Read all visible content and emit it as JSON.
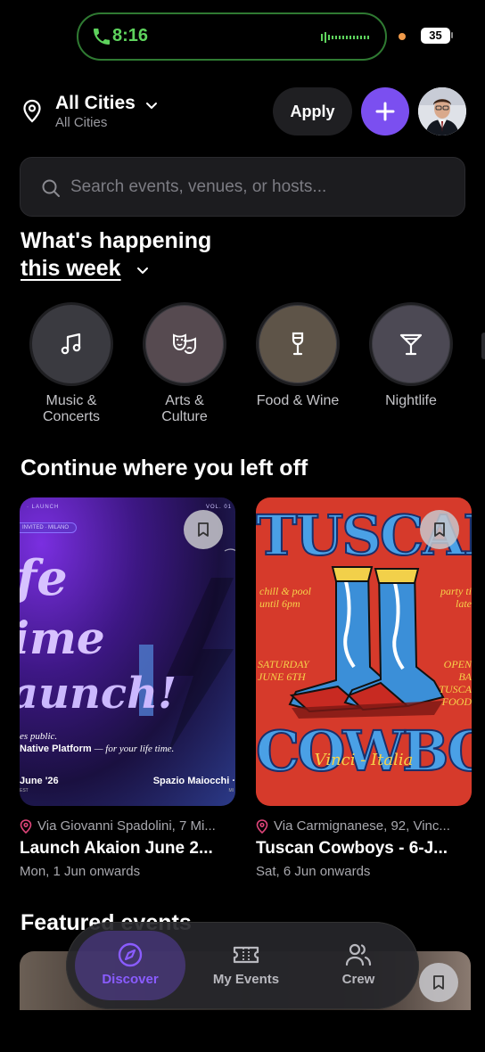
{
  "status": {
    "call_time": "8:16",
    "battery": "35"
  },
  "header": {
    "city_title": "All Cities",
    "city_subtitle": "All Cities",
    "apply_label": "Apply"
  },
  "search": {
    "placeholder": "Search events, venues, or hosts..."
  },
  "section": {
    "happening": "What's happening",
    "period": "this week",
    "continue": "Continue where you left off",
    "featured": "Featured events"
  },
  "categories": [
    {
      "label": "Music & Concerts",
      "color": "#3a3a40"
    },
    {
      "label": "Arts & Culture",
      "color": "#564a50"
    },
    {
      "label": "Food & Wine",
      "color": "#5e5448"
    },
    {
      "label": "Nightlife",
      "color": "#4c4954"
    }
  ],
  "cards": [
    {
      "location": "Via Giovanni Spadolini, 7 Mi...",
      "title": "Launch Akaion June 2...",
      "date": "Mon, 1 Jun onwards",
      "poster": {
        "top_left": "· LAUNCH",
        "top_right": "VOL. 01",
        "badge": "INVITED · MILANO",
        "line1": "fe",
        "line2": "ime",
        "line3": "aunch!",
        "sub1": "es public.",
        "sub2": "Native Platform",
        "sub3": "— for your life time.",
        "bottom_left": "June '26",
        "bottom_left_small": "EST",
        "bottom_right": "Spazio Maiocchi ·",
        "bottom_right_small": "MI"
      }
    },
    {
      "location": "Via Carmignanese, 92, Vinc...",
      "title": "Tuscan Cowboys - 6-J...",
      "date": "Sat, 6 Jun onwards",
      "poster": {
        "top": "TUSCAN",
        "bottom": "COWBOY",
        "left_top": "chill & pool until 6pm",
        "right_top": "party ti late",
        "left_mid": "SATURDAY JUNE 6TH",
        "right_mid": "OPEN BA TUSCA FOOD",
        "script": "Vinci - Italia"
      }
    }
  ],
  "nav": [
    {
      "label": "Discover",
      "icon": "compass-icon",
      "active": true
    },
    {
      "label": "My Events",
      "icon": "ticket-icon",
      "active": false
    },
    {
      "label": "Crew",
      "icon": "users-icon",
      "active": false
    }
  ],
  "colors": {
    "accent": "#7b4ff0",
    "call_green": "#5ed35d",
    "poster_red": "#d83a2a",
    "poster_blue": "#3b8fd8"
  }
}
